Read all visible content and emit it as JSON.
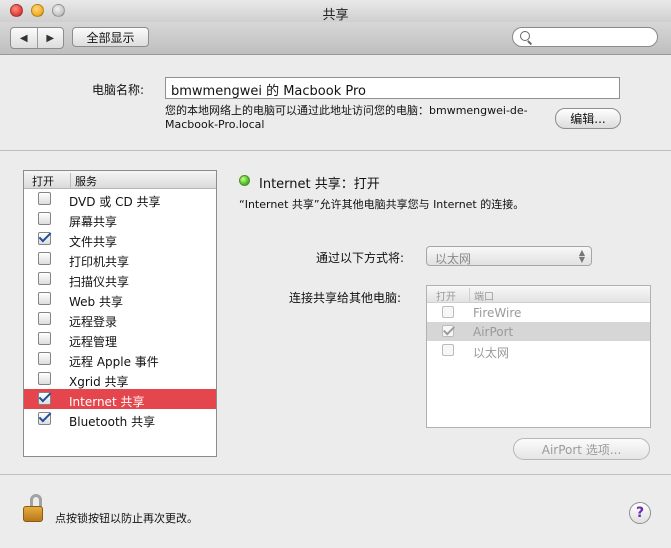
{
  "window": {
    "title": "共享",
    "toolbar": {
      "back_icon": "◀",
      "forward_icon": "▶",
      "show_all_label": "全部显示",
      "search_placeholder": ""
    }
  },
  "computer_name": {
    "label": "电脑名称:",
    "value": "bmwmengwei 的 Macbook Pro",
    "hint_line1": "您的本地网络上的电脑可以通过此地址访问您的电脑：bmwmengwei-de-",
    "hint_line2": "Macbook-Pro.local",
    "edit_label": "编辑..."
  },
  "service_list": {
    "header_on": "打开",
    "header_service": "服务",
    "items": [
      {
        "label": "DVD 或 CD 共享",
        "checked": false,
        "selected": false
      },
      {
        "label": "屏幕共享",
        "checked": false,
        "selected": false
      },
      {
        "label": "文件共享",
        "checked": true,
        "selected": false
      },
      {
        "label": "打印机共享",
        "checked": false,
        "selected": false
      },
      {
        "label": "扫描仪共享",
        "checked": false,
        "selected": false
      },
      {
        "label": "Web 共享",
        "checked": false,
        "selected": false
      },
      {
        "label": "远程登录",
        "checked": false,
        "selected": false
      },
      {
        "label": "远程管理",
        "checked": false,
        "selected": false
      },
      {
        "label": "远程 Apple 事件",
        "checked": false,
        "selected": false
      },
      {
        "label": "Xgrid 共享",
        "checked": false,
        "selected": false
      },
      {
        "label": "Internet 共享",
        "checked": true,
        "selected": true
      },
      {
        "label": "Bluetooth 共享",
        "checked": true,
        "selected": false
      }
    ]
  },
  "detail": {
    "status_title": "Internet 共享：打开",
    "description": "“Internet 共享”允许其他电脑共享您与 Internet 的连接。",
    "connect_label": "通过以下方式将:",
    "connect_value": "以太网",
    "share_label": "连接共享给其他电脑:",
    "ports_header_on": "打开",
    "ports_header_port": "端口",
    "ports": [
      {
        "label": "FireWire",
        "checked": false,
        "selected": false
      },
      {
        "label": "AirPort",
        "checked": true,
        "selected": true
      },
      {
        "label": "以太网",
        "checked": false,
        "selected": false
      }
    ],
    "airport_options_label": "AirPort 选项..."
  },
  "bottom": {
    "lock_text": "点按锁按钮以防止再次更改。",
    "help_label": "?"
  },
  "colors": {
    "selection": "#e5454d",
    "status_green": "#59c42b"
  }
}
